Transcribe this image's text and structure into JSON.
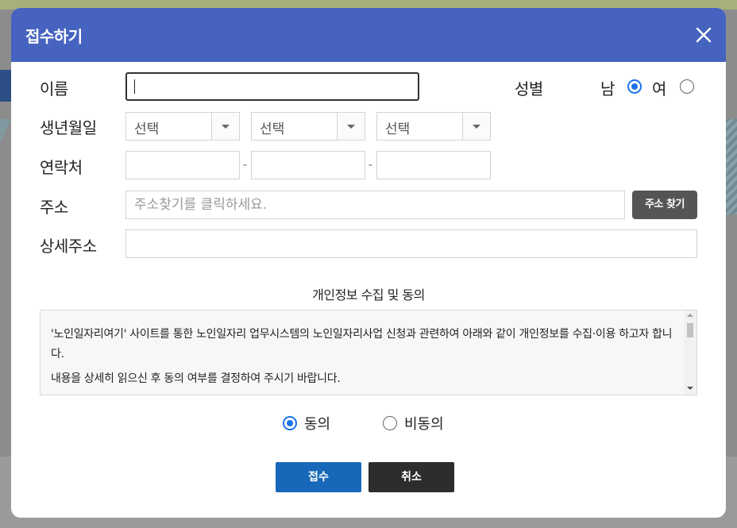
{
  "modal": {
    "title": "접수하기",
    "close_icon": "close-icon"
  },
  "form": {
    "name_label": "이름",
    "name_value": "",
    "gender_label": "성별",
    "gender_options": [
      {
        "label": "남",
        "checked": true
      },
      {
        "label": "여",
        "checked": false
      }
    ],
    "birth_label": "생년월일",
    "birth_selects": [
      "선택",
      "선택",
      "선택"
    ],
    "phone_label": "연락처",
    "phone_separator": "-",
    "phone_values": [
      "",
      "",
      ""
    ],
    "address_label": "주소",
    "address_placeholder": "주소찾기를 클릭하세요.",
    "address_button": "주소 찾기",
    "detail_address_label": "상세주소",
    "detail_address_value": ""
  },
  "privacy": {
    "title": "개인정보 수집 및 동의",
    "paragraph_1": "'노인일자리여기' 사이트를 통한 노인일자리 업무시스템의 노인일자리사업 신청과 관련하여 아래와 같이 개인정보를 수집·이용 하고자 합니다.",
    "paragraph_2": "내용을 상세히 읽으신 후 동의 여부를 결정하여 주시기 바랍니다.",
    "options": [
      {
        "label": "동의",
        "checked": true
      },
      {
        "label": "비동의",
        "checked": false
      }
    ]
  },
  "actions": {
    "submit_label": "접수",
    "cancel_label": "취소"
  },
  "colors": {
    "header": "#4663c0",
    "submit": "#1768b8",
    "cancel": "#2d2d2d",
    "address_button": "#555555",
    "radio_checked": "#1a73e8"
  }
}
